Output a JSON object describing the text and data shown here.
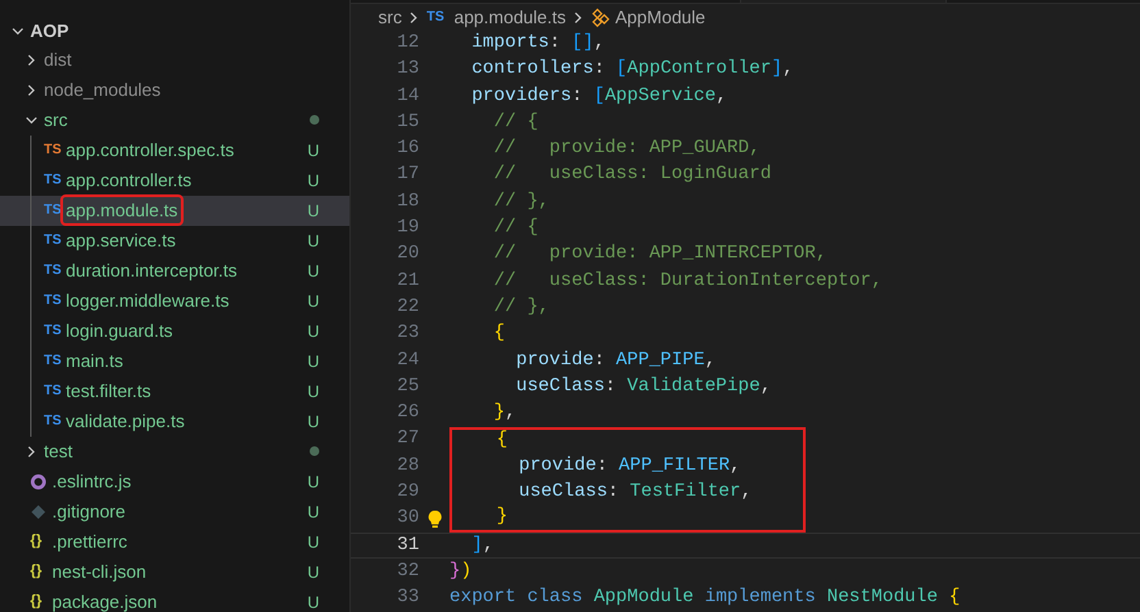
{
  "explorer": {
    "tree": [
      {
        "kind": "folder",
        "label": "AOP",
        "expanded": true,
        "selected": false,
        "root": true,
        "children": [
          {
            "kind": "folder",
            "label": "dist",
            "expanded": false,
            "selected": false,
            "ignored": true
          },
          {
            "kind": "folder",
            "label": "node_modules",
            "expanded": false,
            "selected": false,
            "ignored": true
          },
          {
            "kind": "folder",
            "label": "src",
            "expanded": true,
            "selected": false,
            "status": {
              "kind": "dot"
            },
            "children": [
              {
                "kind": "test-file",
                "badge": "TS",
                "label": "app.controller.spec.ts",
                "selected": false,
                "status": {
                  "kind": "letter",
                  "text": "U"
                }
              },
              {
                "kind": "ts-file",
                "badge": "TS",
                "label": "app.controller.ts",
                "selected": false,
                "status": {
                  "kind": "letter",
                  "text": "U"
                }
              },
              {
                "kind": "ts-file",
                "badge": "TS",
                "label": "app.module.ts",
                "selected": true,
                "highlighted": true,
                "status": {
                  "kind": "letter",
                  "text": "U"
                }
              },
              {
                "kind": "ts-file",
                "badge": "TS",
                "label": "app.service.ts",
                "selected": false,
                "status": {
                  "kind": "letter",
                  "text": "U"
                }
              },
              {
                "kind": "ts-file",
                "badge": "TS",
                "label": "duration.interceptor.ts",
                "selected": false,
                "status": {
                  "kind": "letter",
                  "text": "U"
                }
              },
              {
                "kind": "ts-file",
                "badge": "TS",
                "label": "logger.middleware.ts",
                "selected": false,
                "status": {
                  "kind": "letter",
                  "text": "U"
                }
              },
              {
                "kind": "ts-file",
                "badge": "TS",
                "label": "login.guard.ts",
                "selected": false,
                "status": {
                  "kind": "letter",
                  "text": "U"
                }
              },
              {
                "kind": "ts-file",
                "badge": "TS",
                "label": "main.ts",
                "selected": false,
                "status": {
                  "kind": "letter",
                  "text": "U"
                }
              },
              {
                "kind": "ts-file",
                "badge": "TS",
                "label": "test.filter.ts",
                "selected": false,
                "status": {
                  "kind": "letter",
                  "text": "U"
                }
              },
              {
                "kind": "ts-file",
                "badge": "TS",
                "label": "validate.pipe.ts",
                "selected": false,
                "status": {
                  "kind": "letter",
                  "text": "U"
                }
              }
            ]
          },
          {
            "kind": "folder",
            "label": "test",
            "expanded": false,
            "selected": false,
            "status": {
              "kind": "dot"
            }
          },
          {
            "kind": "eslint-file",
            "label": ".eslintrc.js",
            "selected": false,
            "status": {
              "kind": "letter",
              "text": "U"
            }
          },
          {
            "kind": "git-file",
            "label": ".gitignore",
            "selected": false,
            "status": {
              "kind": "letter",
              "text": "U"
            }
          },
          {
            "kind": "json-file",
            "badge": "{}",
            "label": ".prettierrc",
            "selected": false,
            "status": {
              "kind": "letter",
              "text": "U"
            }
          },
          {
            "kind": "json-file",
            "badge": "{}",
            "label": "nest-cli.json",
            "selected": false,
            "status": {
              "kind": "letter",
              "text": "U"
            }
          },
          {
            "kind": "json-file",
            "badge": "{}",
            "label": "package.json",
            "selected": false,
            "status": {
              "kind": "letter",
              "text": "U"
            }
          }
        ]
      }
    ]
  },
  "editor": {
    "breadcrumb": [
      {
        "kind": "folder",
        "label": "src"
      },
      {
        "kind": "ts-file",
        "badge": "TS",
        "label": "app.module.ts"
      },
      {
        "kind": "symbol",
        "label": "AppModule"
      }
    ],
    "lines": [
      {
        "number": "12",
        "tokens": [
          {
            "text": "  imports",
            "kind": "key"
          },
          {
            "text": ": ",
            "kind": "punct"
          },
          {
            "text": "[]",
            "kind": "bracket3"
          },
          {
            "text": ",",
            "kind": "punct"
          }
        ]
      },
      {
        "number": "13",
        "tokens": [
          {
            "text": "  controllers",
            "kind": "key"
          },
          {
            "text": ": ",
            "kind": "punct"
          },
          {
            "text": "[",
            "kind": "bracket3"
          },
          {
            "text": "AppController",
            "kind": "class"
          },
          {
            "text": "]",
            "kind": "bracket3"
          },
          {
            "text": ",",
            "kind": "punct"
          }
        ]
      },
      {
        "number": "14",
        "tokens": [
          {
            "text": "  providers",
            "kind": "key"
          },
          {
            "text": ": ",
            "kind": "punct"
          },
          {
            "text": "[",
            "kind": "bracket3"
          },
          {
            "text": "AppService",
            "kind": "class"
          },
          {
            "text": ",",
            "kind": "punct"
          }
        ]
      },
      {
        "number": "15",
        "tokens": [
          {
            "text": "    // {",
            "kind": "comment"
          }
        ]
      },
      {
        "number": "16",
        "tokens": [
          {
            "text": "    //   provide: APP_GUARD,",
            "kind": "comment"
          }
        ]
      },
      {
        "number": "17",
        "tokens": [
          {
            "text": "    //   useClass: LoginGuard",
            "kind": "comment"
          }
        ]
      },
      {
        "number": "18",
        "tokens": [
          {
            "text": "    // },",
            "kind": "comment"
          }
        ]
      },
      {
        "number": "19",
        "tokens": [
          {
            "text": "    // {",
            "kind": "comment"
          }
        ]
      },
      {
        "number": "20",
        "tokens": [
          {
            "text": "    //   provide: APP_INTERCEPTOR,",
            "kind": "comment"
          }
        ]
      },
      {
        "number": "21",
        "tokens": [
          {
            "text": "    //   useClass: DurationInterceptor,",
            "kind": "comment"
          }
        ]
      },
      {
        "number": "22",
        "tokens": [
          {
            "text": "    // },",
            "kind": "comment"
          }
        ]
      },
      {
        "number": "23",
        "tokens": [
          {
            "text": "    {",
            "kind": "bracket1"
          }
        ]
      },
      {
        "number": "24",
        "tokens": [
          {
            "text": "      provide",
            "kind": "key"
          },
          {
            "text": ": ",
            "kind": "punct"
          },
          {
            "text": "APP_PIPE",
            "kind": "const"
          },
          {
            "text": ",",
            "kind": "punct"
          }
        ]
      },
      {
        "number": "25",
        "tokens": [
          {
            "text": "      useClass",
            "kind": "key"
          },
          {
            "text": ": ",
            "kind": "punct"
          },
          {
            "text": "ValidatePipe",
            "kind": "class"
          },
          {
            "text": ",",
            "kind": "punct"
          }
        ]
      },
      {
        "number": "26",
        "tokens": [
          {
            "text": "    }",
            "kind": "bracket1"
          },
          {
            "text": ",",
            "kind": "punct"
          }
        ]
      },
      {
        "number": "27",
        "highlighted": true,
        "tokens": [
          {
            "text": "    {",
            "kind": "bracket1"
          }
        ]
      },
      {
        "number": "28",
        "highlighted": true,
        "tokens": [
          {
            "text": "      provide",
            "kind": "key"
          },
          {
            "text": ": ",
            "kind": "punct"
          },
          {
            "text": "APP_FILTER",
            "kind": "const"
          },
          {
            "text": ",",
            "kind": "punct"
          }
        ]
      },
      {
        "number": "29",
        "highlighted": true,
        "tokens": [
          {
            "text": "      useClass",
            "kind": "key"
          },
          {
            "text": ": ",
            "kind": "punct"
          },
          {
            "text": "TestFilter",
            "kind": "class"
          },
          {
            "text": ",",
            "kind": "punct"
          }
        ]
      },
      {
        "number": "30",
        "highlighted": true,
        "lightbulb": true,
        "tokens": [
          {
            "text": "    }",
            "kind": "bracket1"
          }
        ]
      },
      {
        "number": "31",
        "current": true,
        "tokens": [
          {
            "text": "  ]",
            "kind": "bracket3"
          },
          {
            "text": ",",
            "kind": "punct"
          }
        ]
      },
      {
        "number": "32",
        "tokens": [
          {
            "text": "}",
            "kind": "bracket2"
          },
          {
            "text": ")",
            "kind": "bracket1"
          }
        ]
      },
      {
        "number": "33",
        "tokens": [
          {
            "text": "export class ",
            "kind": "keyword"
          },
          {
            "text": "AppModule",
            "kind": "class"
          },
          {
            "text": " implements ",
            "kind": "keyword"
          },
          {
            "text": "NestModule",
            "kind": "class"
          },
          {
            "text": " {",
            "kind": "bracket1"
          }
        ]
      }
    ]
  }
}
